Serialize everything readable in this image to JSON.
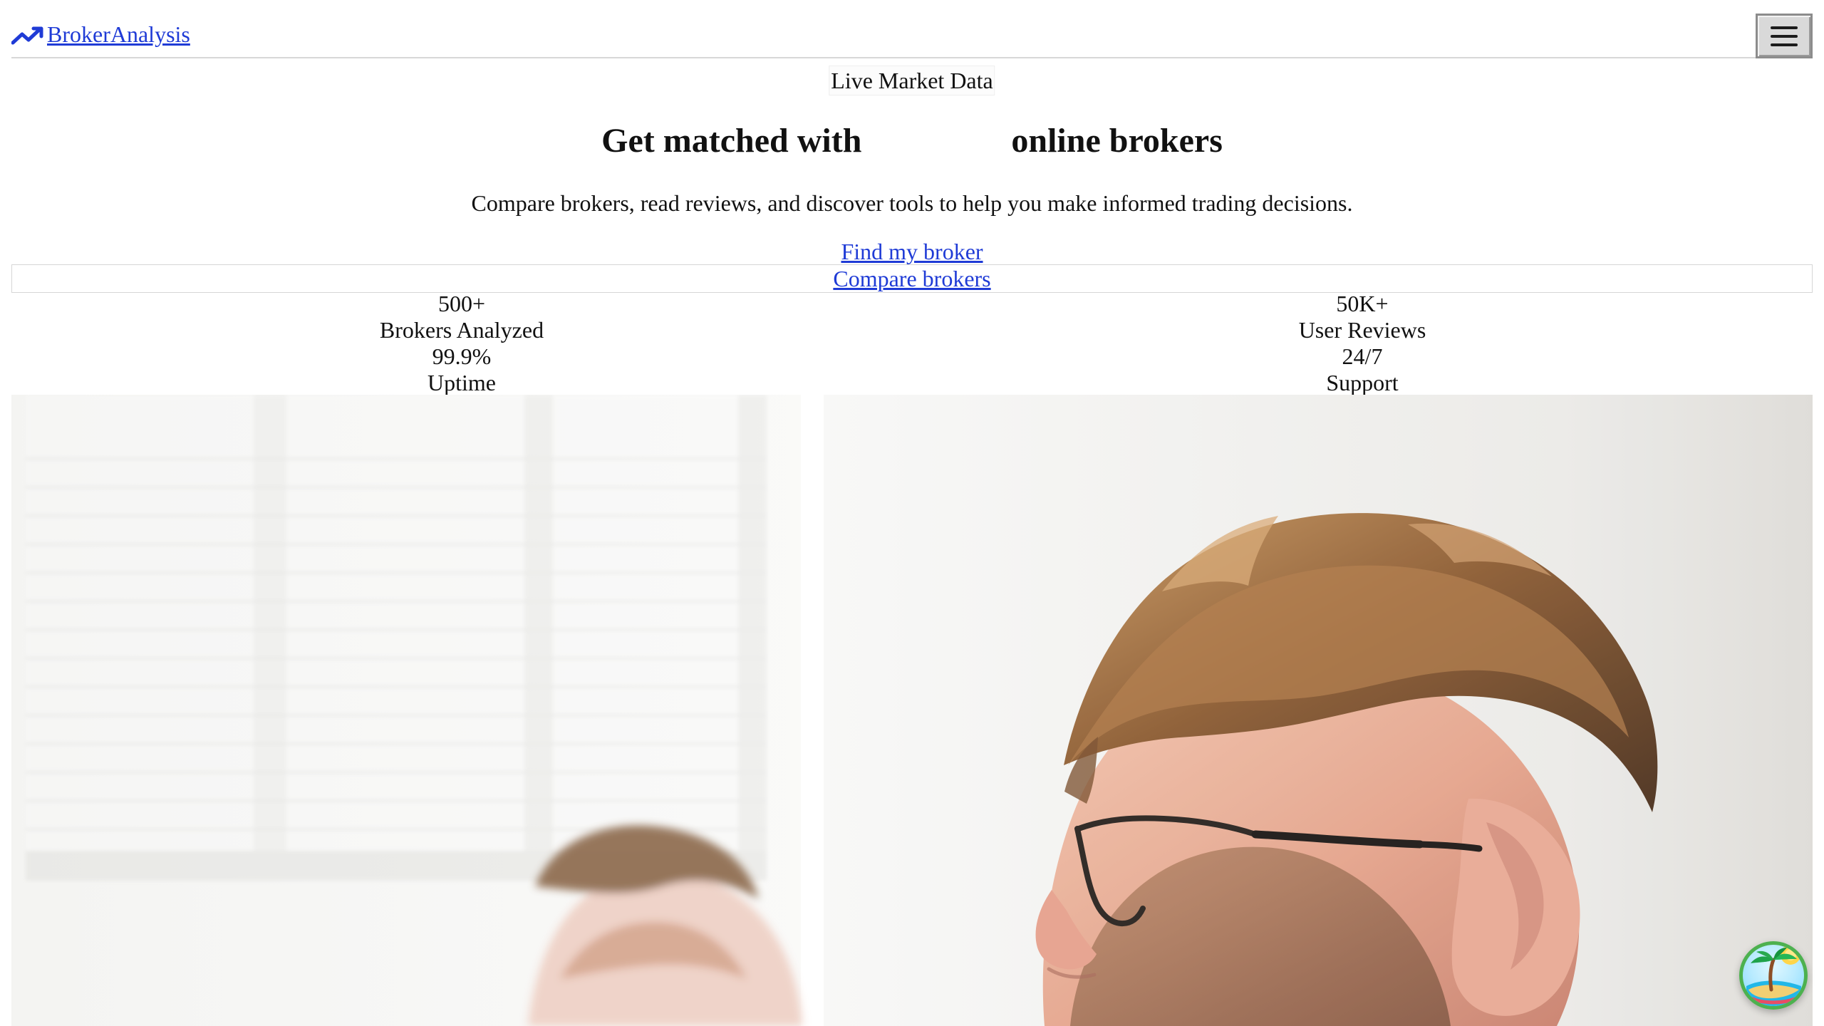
{
  "header": {
    "brand_name": "BrokerAnalysis",
    "brand_icon": "trending-up-icon",
    "menu_icon": "hamburger-menu-icon"
  },
  "hero": {
    "badge": "Live Market Data",
    "title_prefix": "Get matched with",
    "title_suffix": "online brokers",
    "subtitle": "Compare brokers, read reviews, and discover tools to help you make informed trading decisions.",
    "primary_cta": "Find my broker",
    "secondary_cta": "Compare brokers"
  },
  "stats": [
    {
      "value": "500+",
      "label": "Brokers Analyzed"
    },
    {
      "value": "50K+",
      "label": "User Reviews"
    },
    {
      "value": "99.9%",
      "label": "Uptime"
    },
    {
      "value": "24/7",
      "label": "Support"
    }
  ],
  "floating_widget": {
    "icon": "island-icon"
  },
  "colors": {
    "link": "#1f3bd6",
    "text": "#111111",
    "border": "#d6d6d6"
  }
}
